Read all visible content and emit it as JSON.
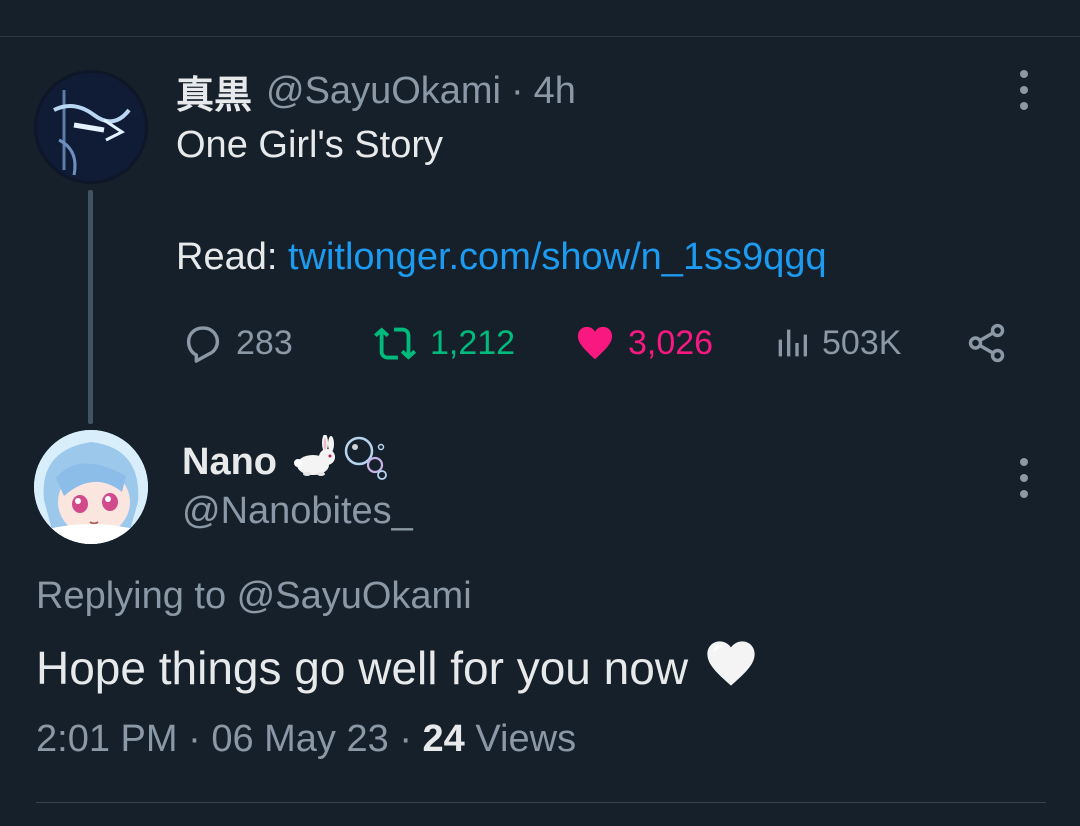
{
  "tweet": {
    "display_name": "真黒",
    "handle": "@SayuOkami",
    "separator": "·",
    "time": "4h",
    "text": "One Girl's Story",
    "read_label": "Read:",
    "link_text": "twitlonger.com/show/n_1ss9qgq",
    "actions": {
      "replies": "283",
      "retweets": "1,212",
      "likes": "3,026",
      "views": "503K"
    },
    "colors": {
      "link": "#1d9bf0",
      "retweet": "#00ba7c",
      "like": "#f91880",
      "muted": "#8b98a5"
    },
    "icons": [
      "reply-icon",
      "retweet-icon",
      "like-icon",
      "views-icon",
      "share-icon",
      "more-icon"
    ]
  },
  "reply": {
    "display_name": "Nano",
    "name_emojis": "🐇🫧",
    "handle": "@Nanobites_",
    "replying_to": "Replying to @SayuOkami",
    "text": "Hope things go well for you now",
    "text_emoji": "🤍",
    "time": "2:01 PM",
    "separator1": "·",
    "date": "06 May 23",
    "separator2": "·",
    "views_count": "24",
    "views_label": "Views"
  },
  "background": "#15202b"
}
